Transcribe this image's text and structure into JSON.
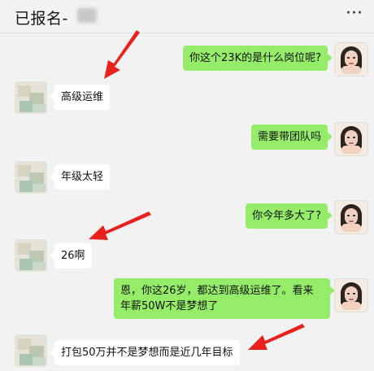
{
  "header": {
    "title": "已报名-",
    "menu_icon": "more-icon",
    "menu_glyph": "···"
  },
  "messages": [
    {
      "side": "right",
      "text": "你这个23K的是什么岗位呢?"
    },
    {
      "side": "left",
      "text": "高级运维"
    },
    {
      "side": "right",
      "text": "需要带团队吗"
    },
    {
      "side": "left",
      "text": "年级太轻"
    },
    {
      "side": "right",
      "text": "你今年多大了?"
    },
    {
      "side": "left",
      "text": "26啊"
    },
    {
      "side": "right",
      "text": "恩，你这26岁，都达到高级运维了。看来年薪50W不是梦想了"
    },
    {
      "side": "left",
      "text": "打包50万并不是梦想而是近几年目标"
    }
  ],
  "annotation_color": "#e8211d",
  "bubble_colors": {
    "sent": "#95ec69",
    "received": "#ffffff"
  }
}
